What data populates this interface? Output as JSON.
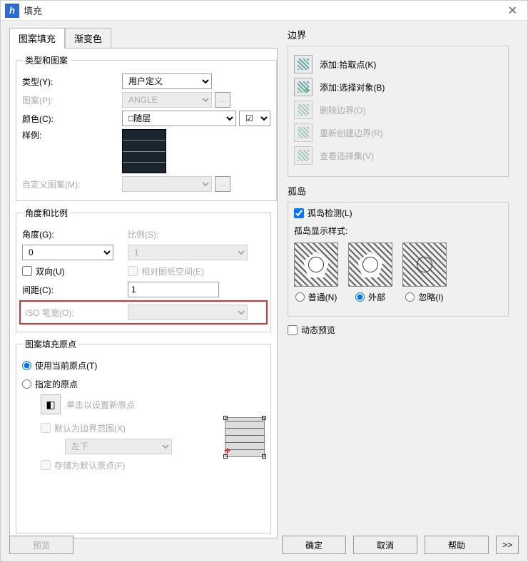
{
  "titlebar": {
    "title": "填充",
    "app_glyph": "h"
  },
  "tabs": {
    "pattern": "图案填充",
    "gradient": "渐变色"
  },
  "type_group": {
    "legend": "类型和图案",
    "type_label": "类型(Y):",
    "type_value": "用户定义",
    "pattern_label": "图案(P):",
    "pattern_value": "ANGLE",
    "color_label": "颜色(C):",
    "color_value": "□随层",
    "sample_label": "样例:",
    "custom_label": "自定义图案(M):",
    "custom_value": "",
    "ellipsis": "..."
  },
  "angle_scale_group": {
    "legend": "角度和比例",
    "angle_label": "角度(G):",
    "angle_value": "0",
    "scale_label": "比例(S):",
    "scale_value": "1",
    "double_label": "双向(U)",
    "paperspace_label": "相对图纸空间(E)",
    "spacing_label": "间距(C):",
    "spacing_value": "1",
    "iso_label": "ISO 笔宽(O):",
    "iso_value": ""
  },
  "origin_group": {
    "legend": "图案填充原点",
    "use_current": "使用当前原点(T)",
    "specify": "指定的原点",
    "click_set": "单击以设置新原点",
    "default_extent": "默认为边界范围(X)",
    "corner_value": "左下",
    "store_default": "存储为默认原点(F)"
  },
  "boundary_group": {
    "title": "边界",
    "add_pick": "添加:拾取点(K)",
    "add_select": "添加:选择对象(B)",
    "delete": "删除边界(D)",
    "recreate": "重新创建边界(R)",
    "view_sel": "查看选择集(V)"
  },
  "island_group": {
    "title": "孤岛",
    "detect": "孤岛检测(L)",
    "style_label": "孤岛显示样式:",
    "normal": "普通(N)",
    "outer": "外部",
    "ignore": "忽略(I)"
  },
  "dynamic_preview": "动态预览",
  "footer": {
    "preview": "预览",
    "ok": "确定",
    "cancel": "取消",
    "help": "帮助",
    "more": ">>"
  }
}
